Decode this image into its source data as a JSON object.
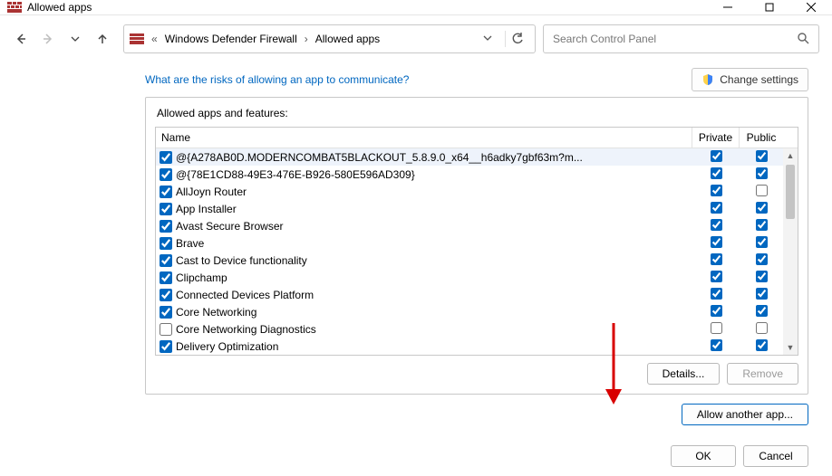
{
  "window": {
    "title": "Allowed apps"
  },
  "breadcrumb": {
    "item1": "Windows Defender Firewall",
    "item2": "Allowed apps"
  },
  "search": {
    "placeholder": "Search Control Panel"
  },
  "topLinks": {
    "risk": "What are the risks of allowing an app to communicate?"
  },
  "changeSettings": {
    "label": "Change settings"
  },
  "group": {
    "title": "Allowed apps and features:",
    "columns": {
      "name": "Name",
      "private": "Private",
      "public": "Public"
    },
    "rows": [
      {
        "enabled": true,
        "name": "@{A278AB0D.MODERNCOMBAT5BLACKOUT_5.8.9.0_x64__h6adky7gbf63m?m...",
        "private": true,
        "public": true
      },
      {
        "enabled": true,
        "name": "@{78E1CD88-49E3-476E-B926-580E596AD309}",
        "private": true,
        "public": true
      },
      {
        "enabled": true,
        "name": "AllJoyn Router",
        "private": true,
        "public": false
      },
      {
        "enabled": true,
        "name": "App Installer",
        "private": true,
        "public": true
      },
      {
        "enabled": true,
        "name": "Avast Secure Browser",
        "private": true,
        "public": true
      },
      {
        "enabled": true,
        "name": "Brave",
        "private": true,
        "public": true
      },
      {
        "enabled": true,
        "name": "Cast to Device functionality",
        "private": true,
        "public": true
      },
      {
        "enabled": true,
        "name": "Clipchamp",
        "private": true,
        "public": true
      },
      {
        "enabled": true,
        "name": "Connected Devices Platform",
        "private": true,
        "public": true
      },
      {
        "enabled": true,
        "name": "Core Networking",
        "private": true,
        "public": true
      },
      {
        "enabled": false,
        "name": "Core Networking Diagnostics",
        "private": false,
        "public": false
      },
      {
        "enabled": true,
        "name": "Delivery Optimization",
        "private": true,
        "public": true
      }
    ],
    "buttons": {
      "details": "Details...",
      "remove": "Remove"
    }
  },
  "allowAnother": {
    "label": "Allow another app..."
  },
  "dialog": {
    "ok": "OK",
    "cancel": "Cancel"
  }
}
